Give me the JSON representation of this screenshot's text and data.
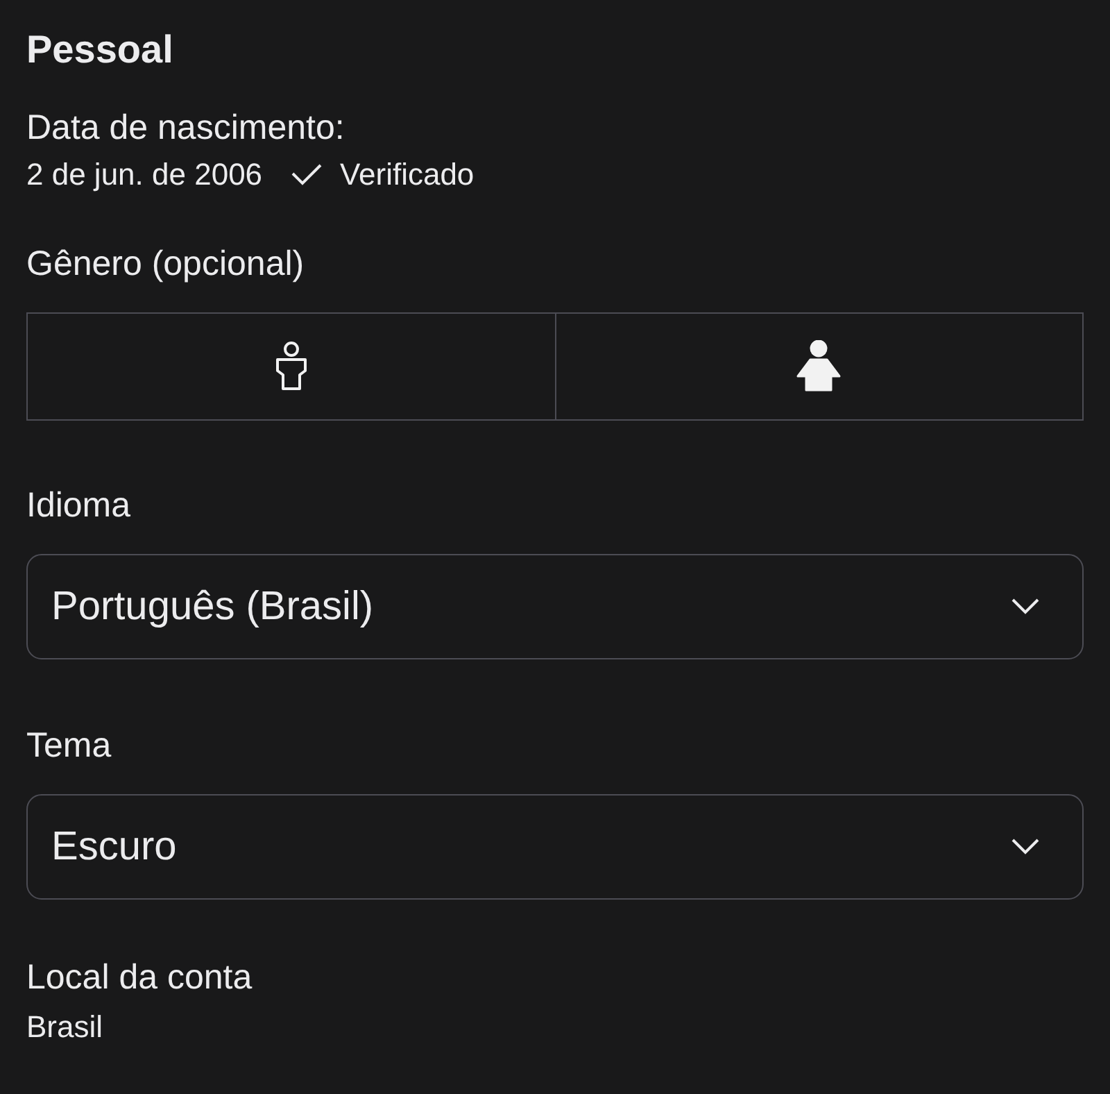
{
  "section_title": "Pessoal",
  "birth_date": {
    "label": "Data de nascimento:",
    "value": "2 de jun. de 2006",
    "status": "Verificado",
    "verified": true
  },
  "gender": {
    "label": "Gênero (opcional)",
    "options": [
      {
        "kind": "male",
        "selected": false
      },
      {
        "kind": "female",
        "selected": true
      }
    ]
  },
  "language": {
    "label": "Idioma",
    "value": "Português (Brasil)"
  },
  "theme": {
    "label": "Tema",
    "value": "Escuro"
  },
  "account_location": {
    "label": "Local da conta",
    "value": "Brasil"
  }
}
